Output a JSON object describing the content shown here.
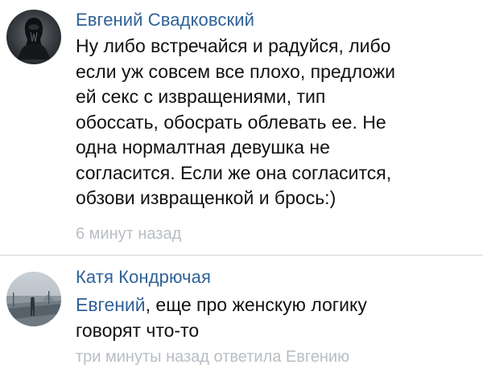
{
  "colors": {
    "author_name": "#2f6199",
    "body_text": "#111111",
    "mention": "#2f6199",
    "meta_text": "#b9bec4",
    "divider": "#d7dade"
  },
  "comments": [
    {
      "author": "Евгений Свадковский",
      "avatar_icon": "dark-figure-avatar",
      "lines": [
        "Ну либо встречайся и радуйся, либо",
        "если уж совсем все плохо, предложи",
        "ей секс с извращениями, тип",
        "обоссать, обосрать облевать ее. Не",
        "одна нормалтная девушка не",
        "согласится. Если же она согласится,",
        "обзови извращенкой и брось:)"
      ],
      "time": "6 минут назад"
    },
    {
      "author": "Катя Кондрючая",
      "avatar_icon": "photo-avatar",
      "mention": "Евгений",
      "first_line_rest": ", еще про женскую логику",
      "second_line": "говорят что-то",
      "time": "три минуты назад ответила Евгению"
    }
  ]
}
